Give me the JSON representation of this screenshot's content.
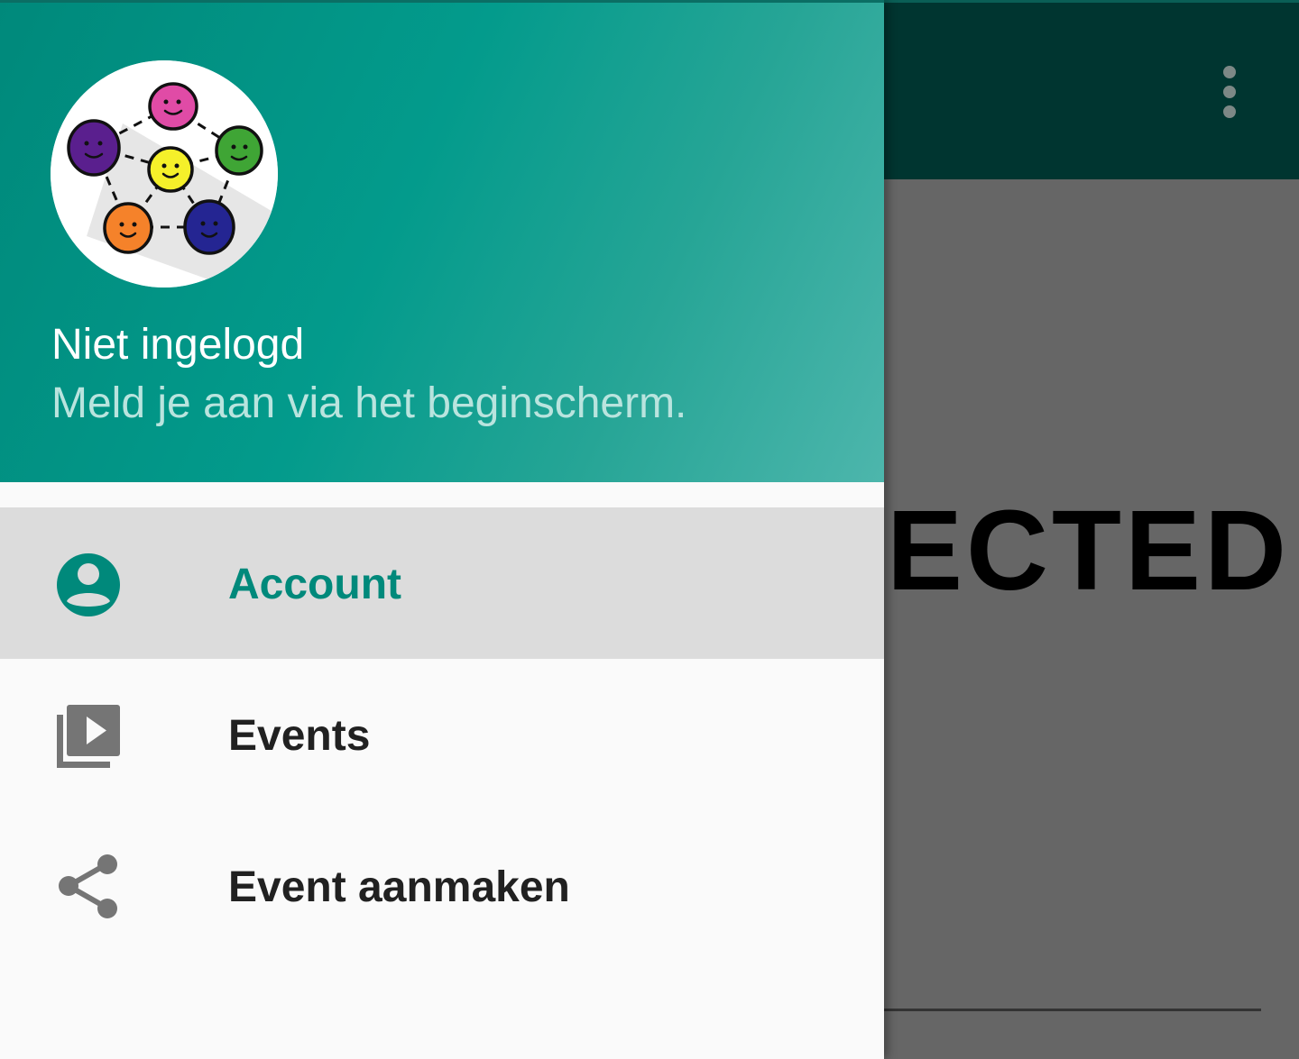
{
  "background_app": {
    "overflow_menu_icon": "more-vert-icon",
    "content_text": "ECTED",
    "colors": {
      "toolbar": "#003530",
      "scrim_content": "#666666"
    }
  },
  "drawer": {
    "header": {
      "logo_icon": "connected-people-logo",
      "title": "Niet ingelogd",
      "subtitle": "Meld je aan via het beginscherm."
    },
    "items": [
      {
        "label": "Account",
        "icon": "account-circle-icon",
        "selected": true
      },
      {
        "label": "Events",
        "icon": "video-library-icon",
        "selected": false
      },
      {
        "label": "Event aanmaken",
        "icon": "share-icon",
        "selected": false
      }
    ],
    "colors": {
      "accent": "#00897b",
      "header_gradient_start": "#00897b",
      "header_gradient_end": "#4db6ac",
      "selected_bg": "#dcdcdc",
      "icon_grey": "#757575"
    }
  }
}
